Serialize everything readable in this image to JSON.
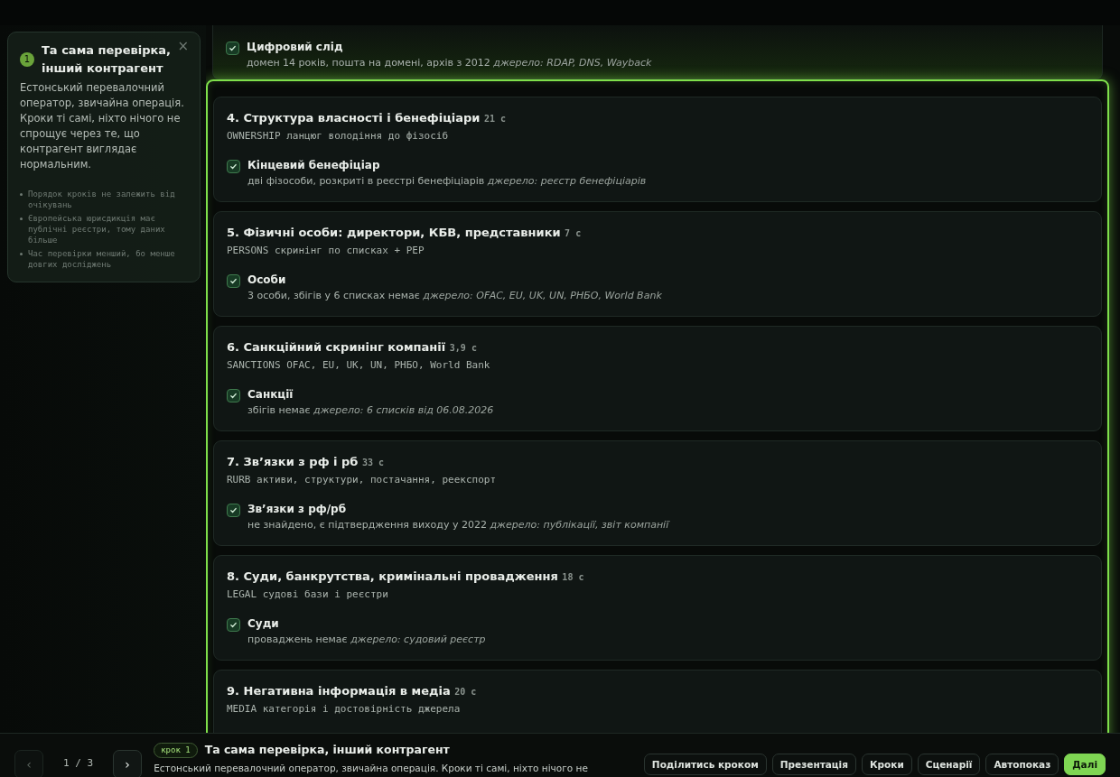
{
  "previous_card": {
    "checks": [
      {
        "label": "Цифровий слід",
        "detail": "домен 14 років, пошта на домені, архів з 2012",
        "source": "джерело: RDAP, DNS, Wayback",
        "checked": true
      }
    ]
  },
  "focus_panel": {
    "highlighted": true,
    "steps": [
      {
        "title": "4. Структура власності і бенефіціари",
        "time": "21 с",
        "code": "OWNERSHIP",
        "description": "ланцюг володіння до фізосіб",
        "checks": [
          {
            "label": "Кінцевий бенефіціар",
            "detail": "дві фізособи, розкриті в реєстрі бенефіціарів",
            "source": "джерело: реєстр бенефіціарів",
            "checked": true
          }
        ]
      },
      {
        "title": "5. Фізичні особи: директори, КБВ, представники",
        "time": "7 с",
        "code": "PERSONS",
        "description": "скринінг по списках + PEP",
        "checks": [
          {
            "label": "Особи",
            "detail": "3 особи, збігів у 6 списках немає",
            "source": "джерело: OFAC, EU, UK, UN, РНБО, World Bank",
            "checked": true
          }
        ]
      },
      {
        "title": "6. Санкційний скринінг компанії",
        "time": "3,9 с",
        "code": "SANCTIONS",
        "description": "OFAC, EU, UK, UN, РНБО, World Bank",
        "checks": [
          {
            "label": "Санкції",
            "detail": "збігів немає",
            "source": "джерело: 6 списків від 06.08.2026",
            "checked": true
          }
        ]
      },
      {
        "title": "7. Зв’язки з рф і рб",
        "time": "33 с",
        "code": "RURB",
        "description": "активи, структури, постачання, реекспорт",
        "checks": [
          {
            "label": "Зв’язки з рф/рб",
            "detail": "не знайдено, є підтвердження виходу у 2022",
            "source": "джерело: публікації, звіт компанії",
            "checked": true
          }
        ]
      },
      {
        "title": "8. Суди, банкрутства, кримінальні провадження",
        "time": "18 с",
        "code": "LEGAL",
        "description": "судові бази і реєстри",
        "checks": [
          {
            "label": "Суди",
            "detail": "проваджень немає",
            "source": "джерело: судовий реєстр",
            "checked": true
          }
        ]
      },
      {
        "title": "9. Негативна інформація в медіа",
        "time": "20 с",
        "code": "MEDIA",
        "description": "категорія і достовірність джерела"
      }
    ]
  },
  "popover": {
    "number": "1",
    "title": "Та сама перевірка, інший контрагент",
    "close": "×",
    "text": "Естонський перевалочний оператор, звичайна операція. Кроки ті самі, ніхто нічого не спрощує через те, що контрагент виглядає нормальним.",
    "points": [
      "Порядок кроків не залежить від очікувань",
      "Європейська юрисдикція має публічні реєстри, тому даних більше",
      "Час перевірки менший, бо менше довгих досліджень"
    ]
  },
  "footer": {
    "prev": {
      "label": "‹",
      "disabled": true
    },
    "counter": "1 / 3",
    "next": {
      "label": "›",
      "disabled": false
    },
    "badge": "крок 1",
    "title": "Та сама перевірка, інший контрагент",
    "text": "Естонський перевалочний оператор, звичайна операція. Кроки ті самі, ніхто нічого не",
    "buttons": [
      {
        "label": "Поділитись кроком",
        "primary": false
      },
      {
        "label": "Презентація",
        "primary": false
      },
      {
        "label": "Кроки",
        "primary": false
      },
      {
        "label": "Сценарії",
        "primary": false
      },
      {
        "label": "Автопоказ",
        "primary": false
      },
      {
        "label": "Далі",
        "primary": true
      }
    ]
  }
}
